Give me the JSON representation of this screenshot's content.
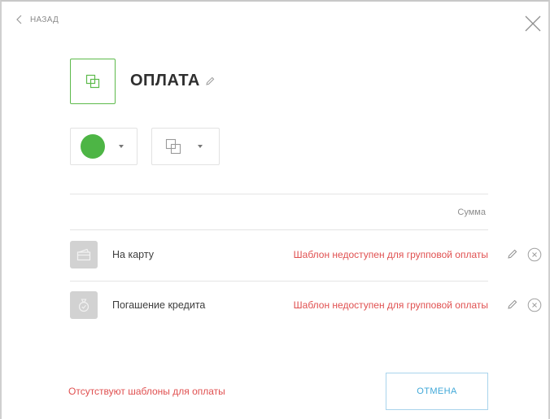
{
  "header": {
    "back_label": "НАЗАД",
    "back_icon": "chevron-left-icon",
    "close_icon": "close-icon"
  },
  "group": {
    "tile_icon": "copy-icon",
    "title": "ОПЛАТА",
    "title_edit_icon": "pencil-icon",
    "color_picker": {
      "selected_color": "#4db545"
    },
    "icon_picker": {
      "selected_icon": "copy-icon"
    }
  },
  "table": {
    "amount_header": "Сумма",
    "rows": [
      {
        "icon": "card-icon",
        "name": "На карту",
        "status": "Шаблон недоступен для групповой оплаты",
        "edit_icon": "pencil-icon",
        "delete_icon": "remove-circle-icon"
      },
      {
        "icon": "money-bag-icon",
        "name": "Погашение кредита",
        "status": "Шаблон недоступен для групповой оплаты",
        "edit_icon": "pencil-icon",
        "delete_icon": "remove-circle-icon"
      }
    ]
  },
  "footer": {
    "message": "Отсутствуют шаблоны для оплаты",
    "cancel_label": "ОТМЕНА"
  },
  "colors": {
    "accent_green": "#4db545",
    "error_red": "#e05050",
    "link_blue": "#40a8d8"
  }
}
